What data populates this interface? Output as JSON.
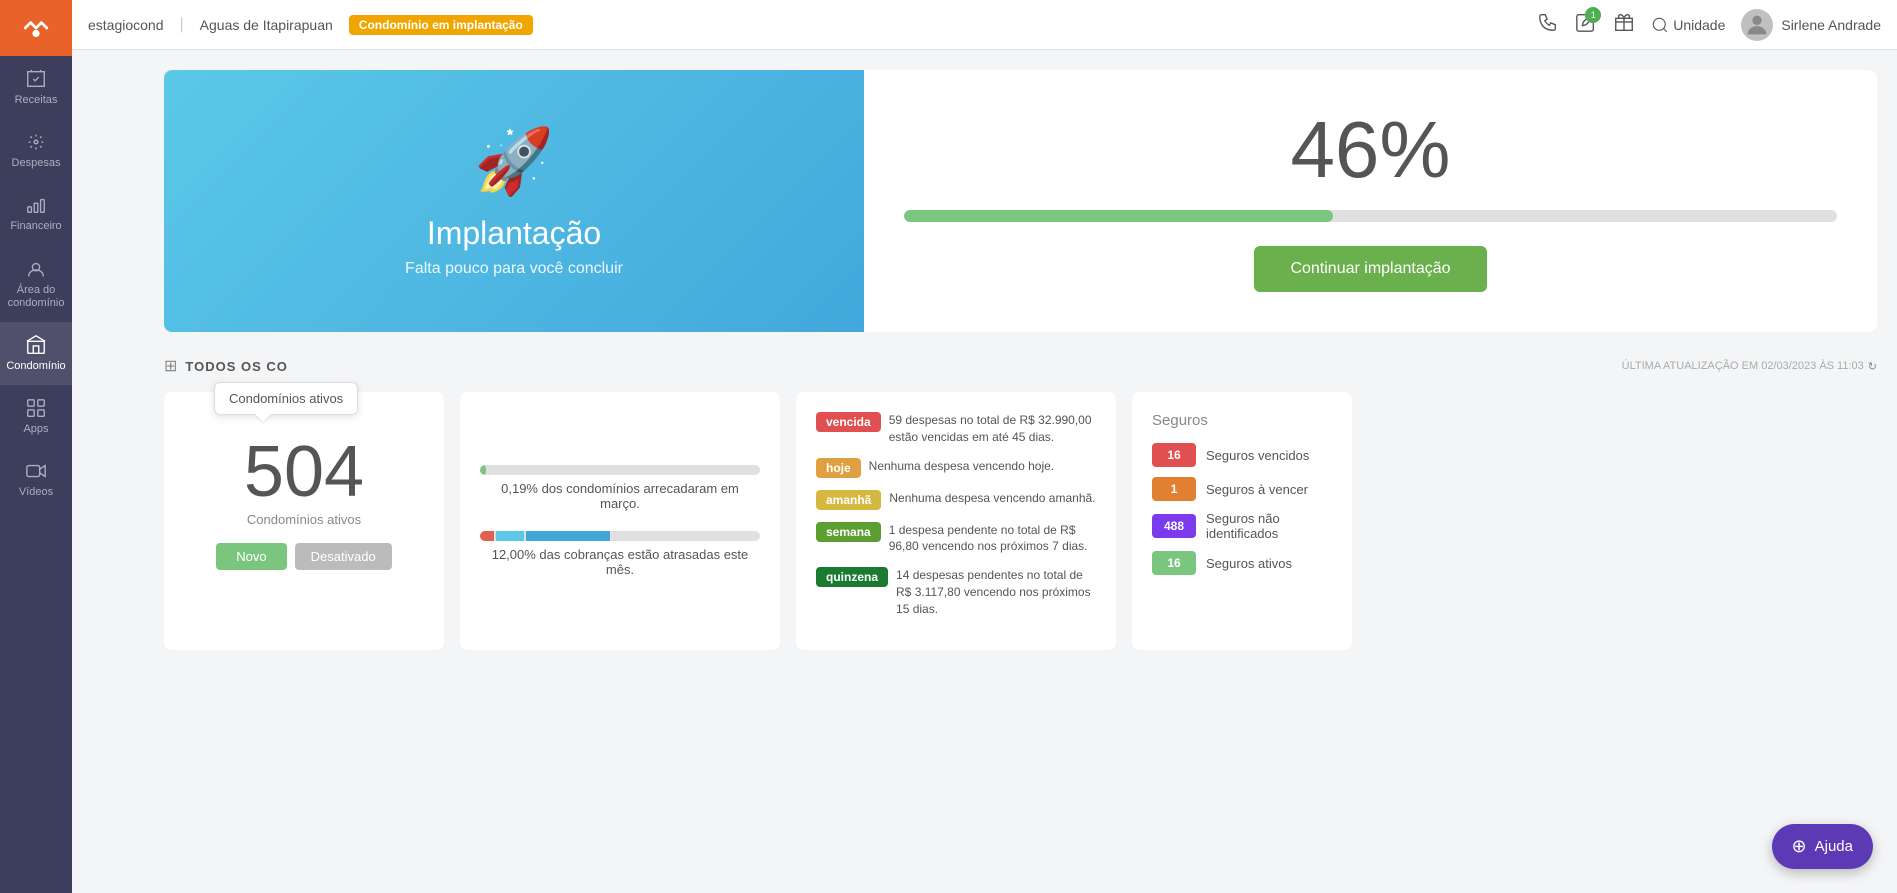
{
  "topbar": {
    "brand": "estagiocond",
    "location": "Aguas de Itapirapuan",
    "status_badge": "Condomínio em implantação",
    "unit_label": "Unidade",
    "user_name": "Sirlene Andrade",
    "notification_count": "1"
  },
  "sidebar": {
    "logo_alt": "logo",
    "items": [
      {
        "id": "receitas",
        "label": "Receitas"
      },
      {
        "id": "despesas",
        "label": "Despesas"
      },
      {
        "id": "financeiro",
        "label": "Financeiro"
      },
      {
        "id": "area-condominio",
        "label": "Área do condomínio"
      },
      {
        "id": "condominio",
        "label": "Condomínio",
        "active": true
      },
      {
        "id": "apps",
        "label": "Apps"
      },
      {
        "id": "videos",
        "label": "Vídeos"
      }
    ]
  },
  "implantacao": {
    "title": "Implantação",
    "subtitle": "Falta pouco para você concluir",
    "progress_percent": "46%",
    "progress_value": 46,
    "continue_btn": "Continuar implantação"
  },
  "dashboard": {
    "title": "TODOS OS CO",
    "last_update": "ÚLTIMA ATUALIZAÇÃO EM 02/03/2023 ÀS 11:03",
    "tooltip": "Condomínios ativos"
  },
  "condominios_card": {
    "count": "504",
    "label": "Condomínios ativos",
    "btn_novo": "Novo",
    "btn_desativado": "Desativado"
  },
  "arrecadacao_card": {
    "bar1_percent": 2,
    "bar1_label": "0,19% dos condomínios arrecadaram em março.",
    "bar2_percent": 12,
    "bar2_label": "12,00% das cobranças estão atrasadas este mês."
  },
  "despesas": [
    {
      "badge": "vencida",
      "badge_class": "badge-vencida",
      "text": "59 despesas no total de R$ 32.990,00 estão vencidas em até 45 dias."
    },
    {
      "badge": "hoje",
      "badge_class": "badge-hoje",
      "text": "Nenhuma despesa vencendo hoje."
    },
    {
      "badge": "amanhã",
      "badge_class": "badge-amanha",
      "text": "Nenhuma despesa vencendo amanhã."
    },
    {
      "badge": "semana",
      "badge_class": "badge-semana",
      "text": "1 despesa pendente no total de R$ 96,80 vencendo nos próximos 7 dias."
    },
    {
      "badge": "quinzena",
      "badge_class": "badge-quinzena",
      "text": "14 despesas pendentes no total de R$ 3.117,80 vencendo nos próximos 15 dias."
    }
  ],
  "seguros": {
    "title": "Seguros",
    "items": [
      {
        "count": "16",
        "label": "Seguros vencidos",
        "count_class": "seguro-count-red"
      },
      {
        "count": "1",
        "label": "Seguros à vencer",
        "count_class": "seguro-count-orange"
      },
      {
        "count": "488",
        "label": "Seguros não identificados",
        "count_class": "seguro-count-purple"
      },
      {
        "count": "16",
        "label": "Seguros ativos",
        "count_class": "seguro-count-green"
      }
    ]
  },
  "help": {
    "label": "Ajuda"
  }
}
